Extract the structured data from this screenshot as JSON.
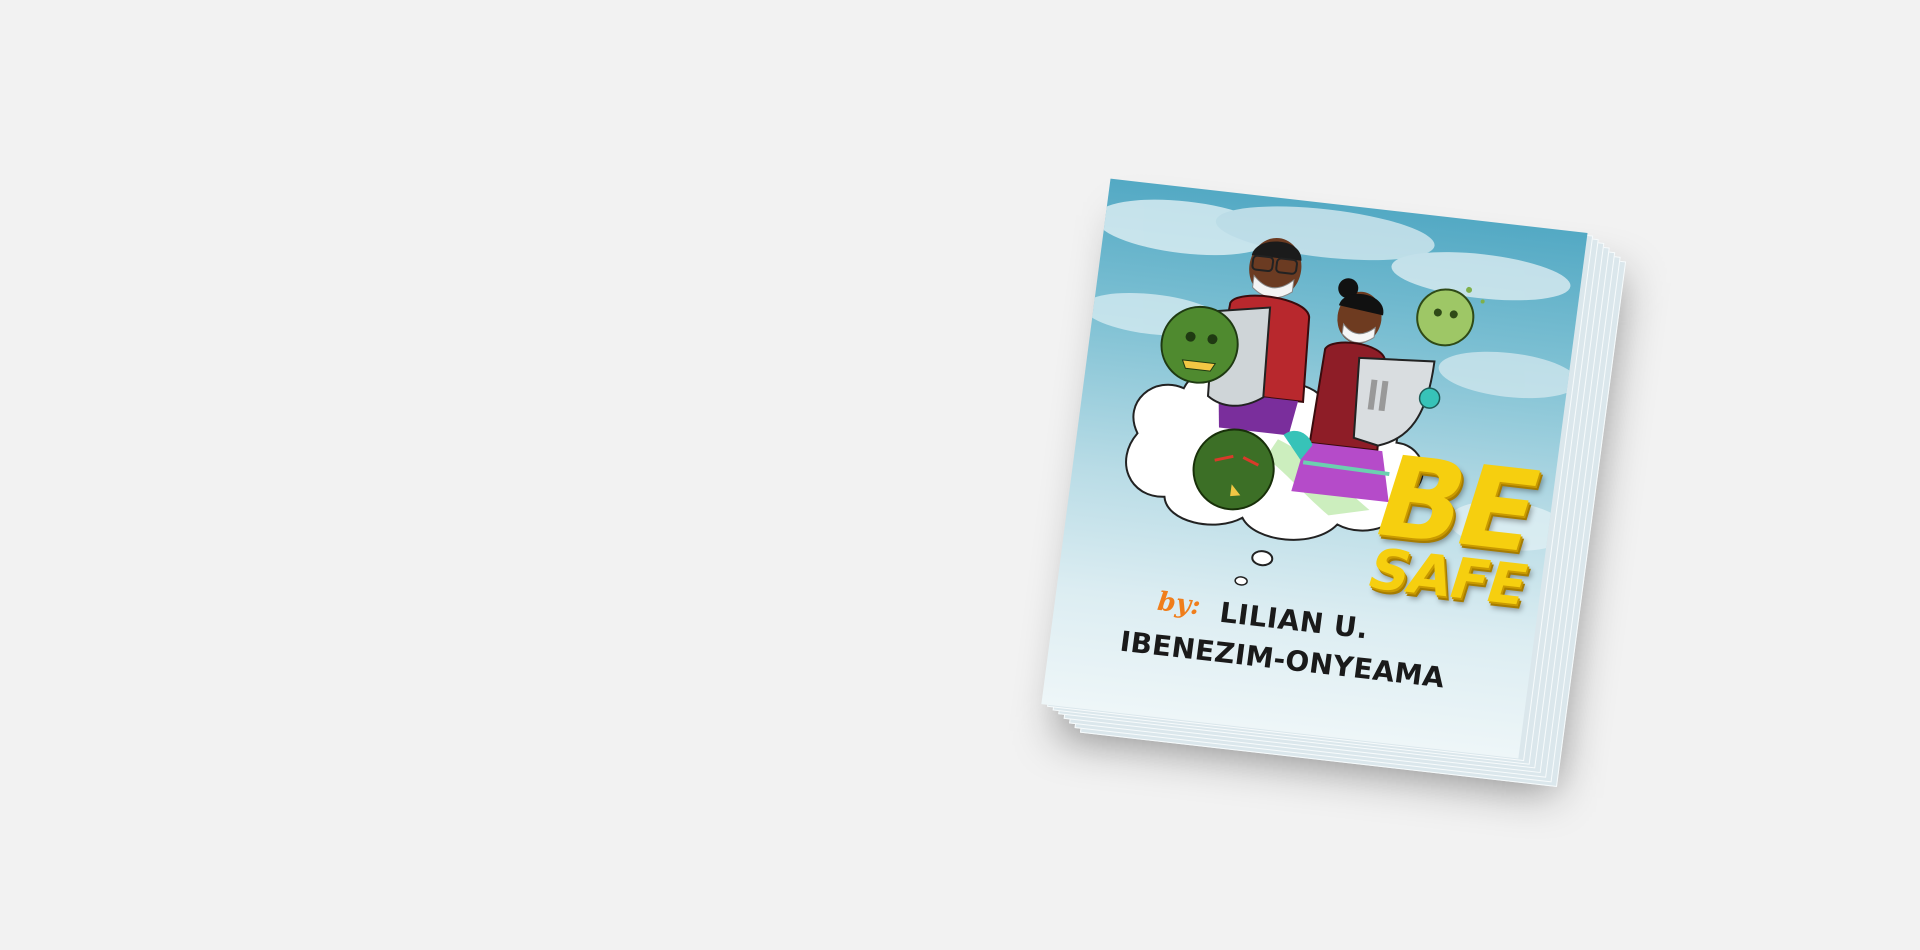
{
  "book": {
    "title_line1": "BE",
    "title_line2": "SAFE",
    "by_label": "by:",
    "author_line1": "LILIAN U.",
    "author_line2": "IBENEZIM-ONYEAMA"
  },
  "colors": {
    "background": "#f2f2f2",
    "sky_top": "#53a9c4",
    "sky_bottom": "#eef6f8",
    "title_yellow": "#f6cf0f",
    "by_orange": "#f07e1b",
    "author_text": "#1a1a1a"
  }
}
